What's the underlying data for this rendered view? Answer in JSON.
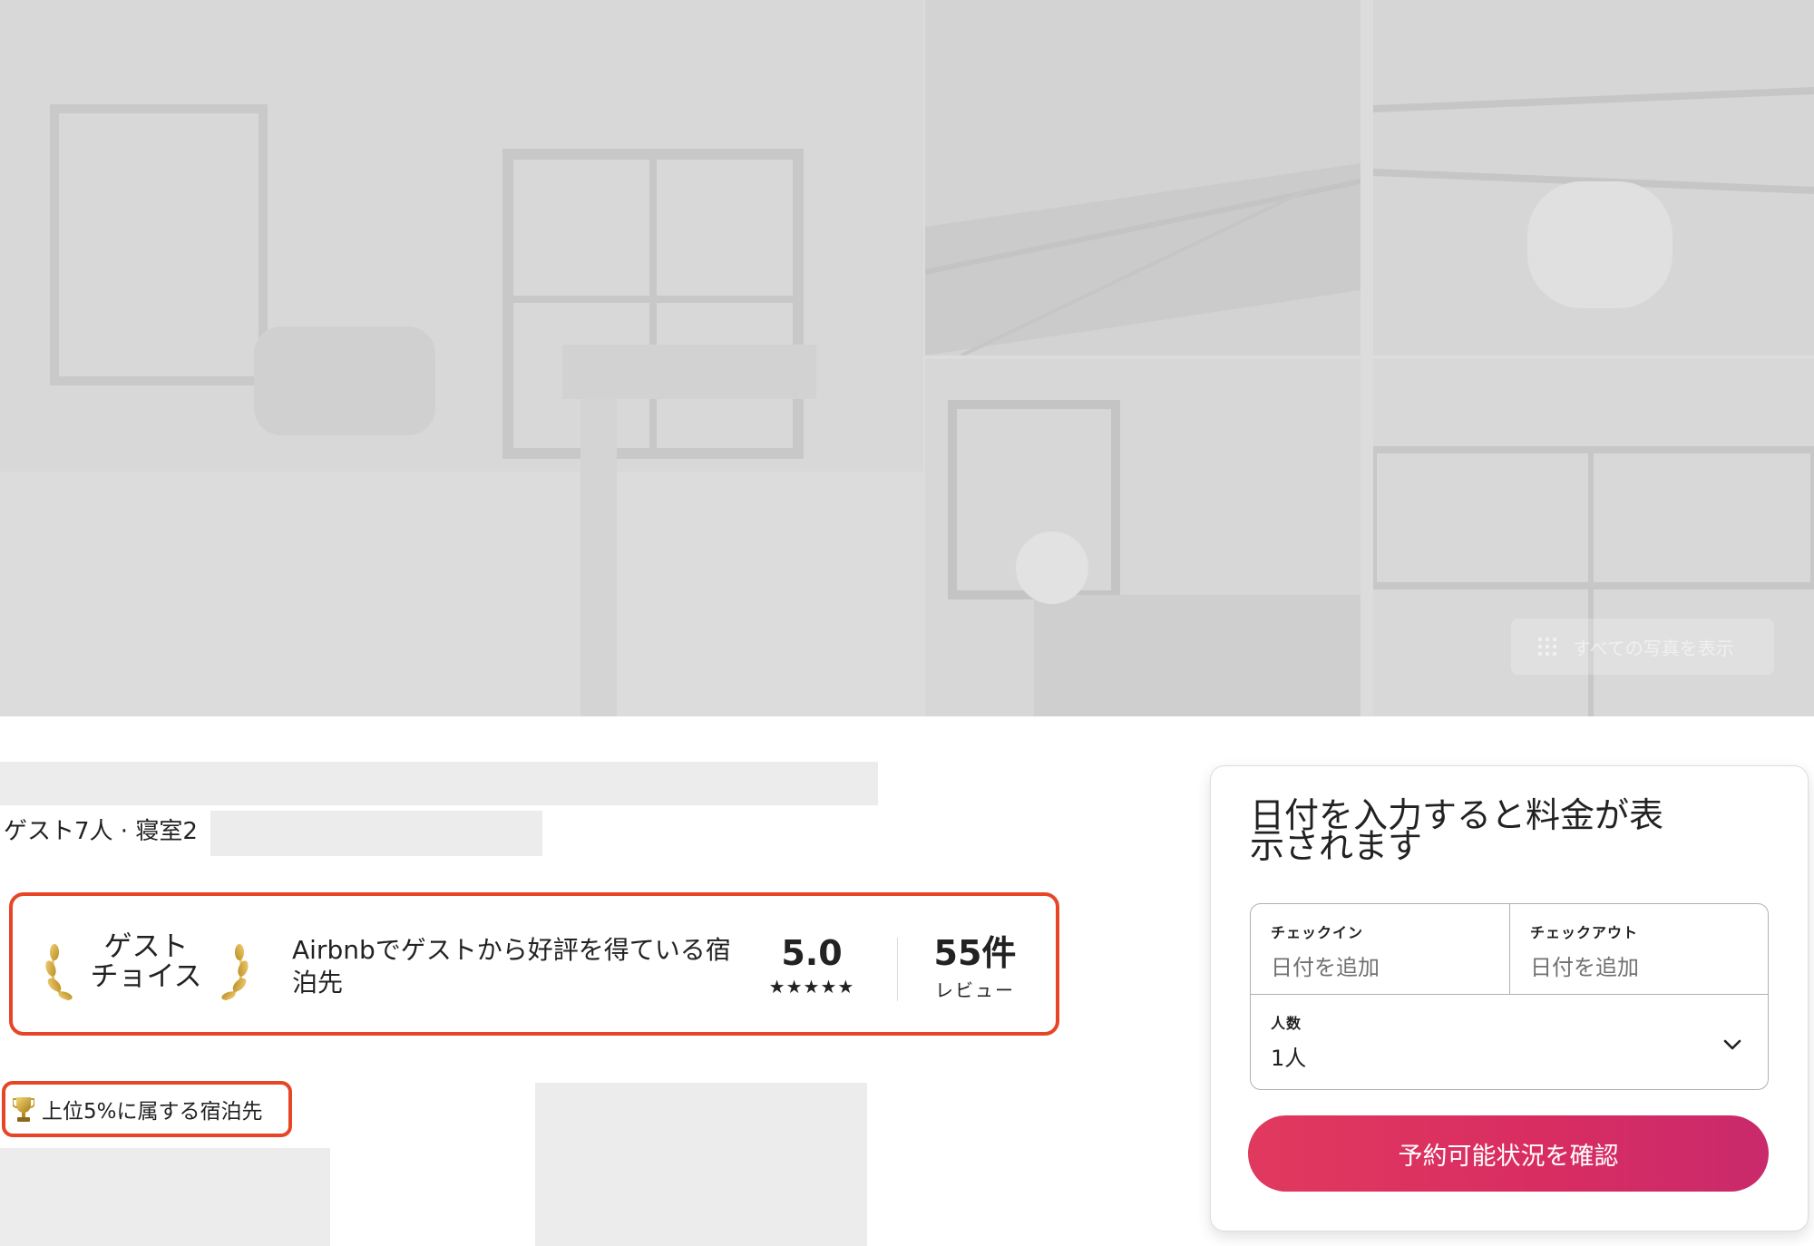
{
  "gallery": {
    "show_all_label": "すべての写真を表示"
  },
  "listing": {
    "summary": "ゲスト7人 · 寝室2"
  },
  "guest_favorite": {
    "title_line1": "ゲスト",
    "title_line2": "チョイス",
    "description": "Airbnbでゲストから好評を得ている宿泊先",
    "rating": "5.0",
    "stars": "★★★★★",
    "reviews_count": "55件",
    "reviews_label": "レビュー"
  },
  "top_badge": {
    "icon": "trophy-icon",
    "label": "上位5%に属する宿泊先"
  },
  "booking": {
    "title": "日付を入力すると料金が表示されます",
    "checkin_label": "チェックイン",
    "checkin_value": "日付を追加",
    "checkout_label": "チェックアウト",
    "checkout_value": "日付を追加",
    "guests_label": "人数",
    "guests_value": "1人",
    "cta_label": "予約可能状況を確認"
  },
  "colors": {
    "highlight_border": "#e64526",
    "cta_start": "#e0395e",
    "cta_end": "#c92a6b"
  }
}
